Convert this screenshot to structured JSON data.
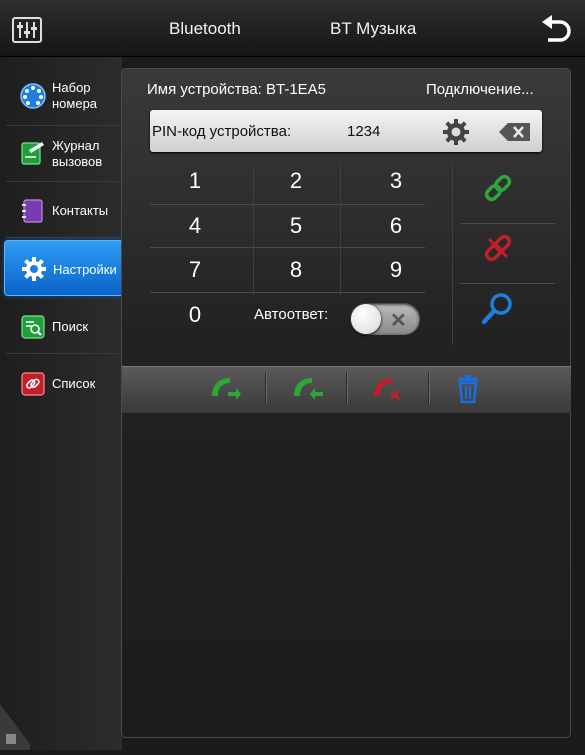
{
  "header": {
    "tab_bluetooth": "Bluetooth",
    "tab_music": "BT Музыка",
    "eq_icon": "equalizer-icon",
    "back_icon": "back-arrow-icon"
  },
  "sidebar": {
    "items": [
      {
        "label": "Набор номера",
        "line1": "Набор",
        "line2": "номера",
        "icon": "dial-icon"
      },
      {
        "label": "Журнал вызовов",
        "line1": "Журнал",
        "line2": "вызовов",
        "icon": "call-log-icon"
      },
      {
        "label": "Контакты",
        "icon": "contacts-icon"
      },
      {
        "label": "Настройки",
        "icon": "settings-gear-icon",
        "active": true
      },
      {
        "label": "Поиск",
        "icon": "search-icon"
      },
      {
        "label": "Список",
        "icon": "list-link-icon"
      }
    ]
  },
  "device": {
    "name_text": "Имя устройства: BT-1EA5",
    "status_text": "Подключение..."
  },
  "pin": {
    "label": "PIN-код устройства:",
    "value": "1234"
  },
  "keypad": {
    "keys": [
      "1",
      "2",
      "3",
      "4",
      "5",
      "6",
      "7",
      "8",
      "9",
      "0"
    ]
  },
  "autoanswer": {
    "label": "Автоответ:",
    "state": "off",
    "off_symbol": "✕"
  },
  "actions": [
    "connect-link-icon",
    "disconnect-link-icon",
    "search-device-icon"
  ],
  "call_toolbar": [
    "outgoing-call-icon",
    "incoming-call-icon",
    "missed-call-icon",
    "trash-icon"
  ],
  "colors": {
    "accent_blue": "#1a7fe0",
    "green": "#2ea63a",
    "red": "#c0202a",
    "panel_bg": "#222222"
  }
}
